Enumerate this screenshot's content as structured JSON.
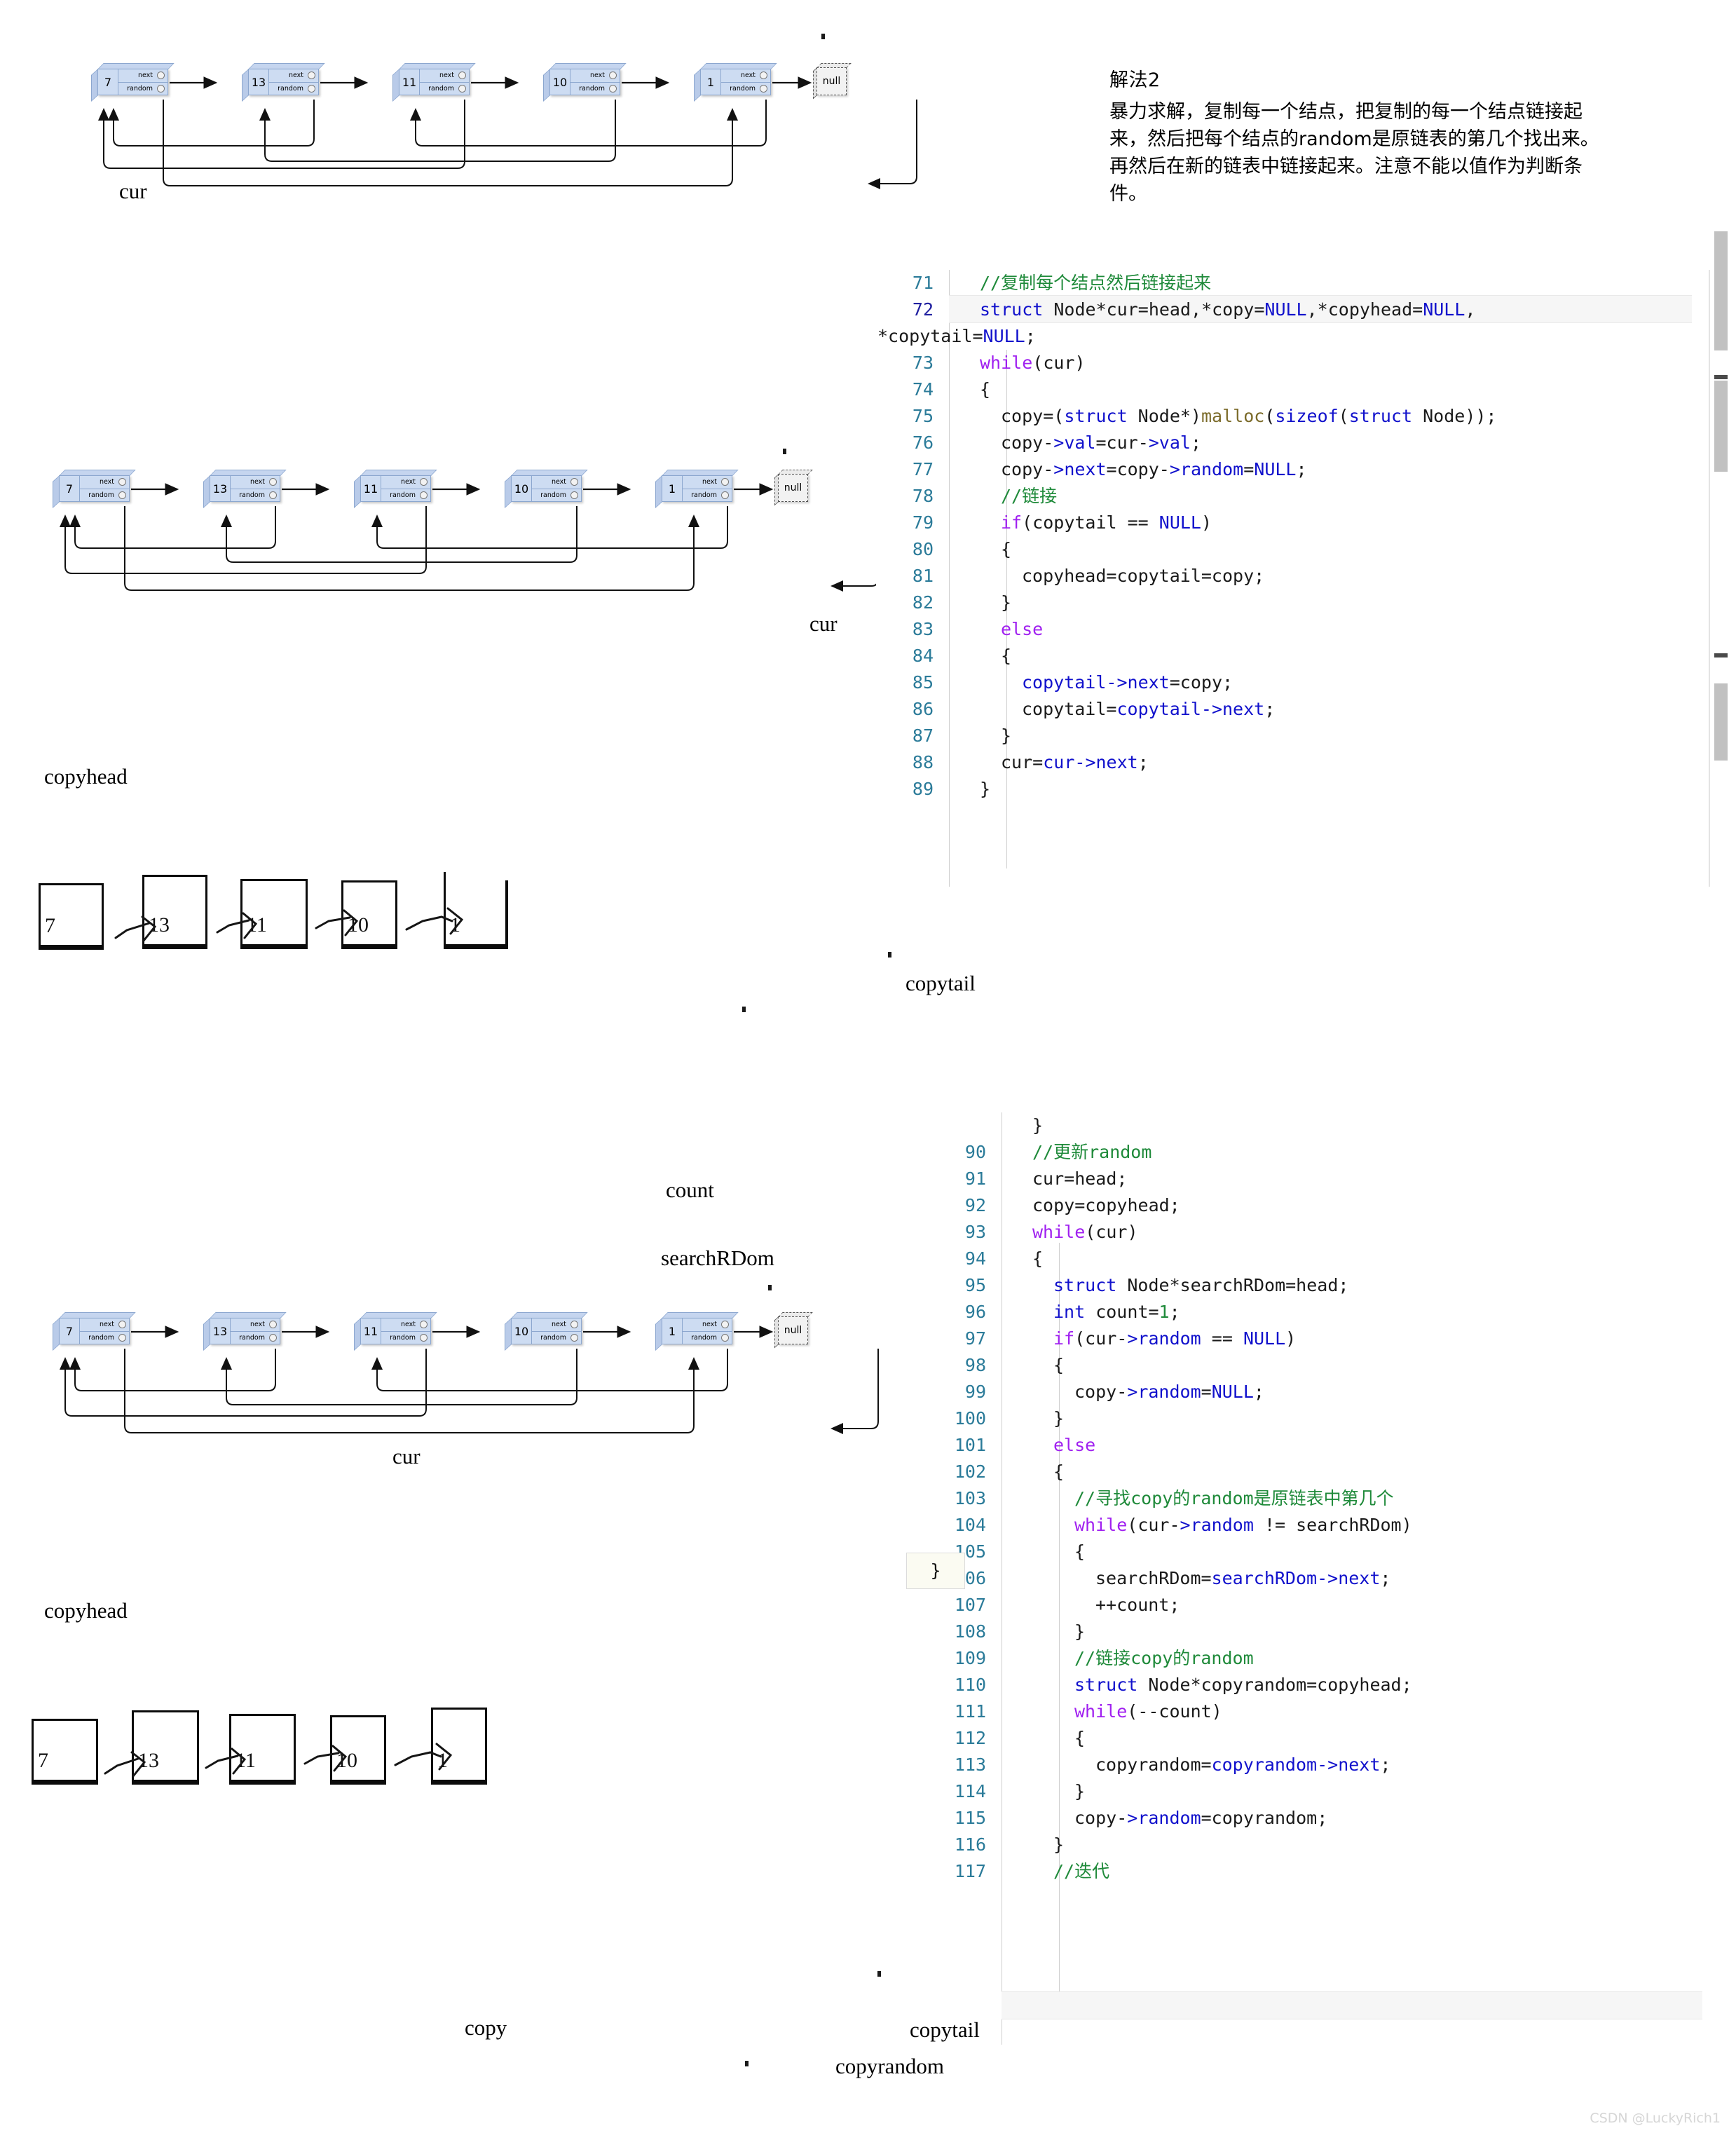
{
  "notes": {
    "title": "解法2",
    "body": "暴力求解，复制每一个结点，把复制的每一个结点链接起来，然后把每个结点的random是原链表的第几个找出来。再然后在新的链表中链接起来。注意不能以值作为判断条件。"
  },
  "diagram1": {
    "nodes": [
      {
        "value": "7",
        "next_label": "next",
        "random_label": "random"
      },
      {
        "value": "13",
        "next_label": "next",
        "random_label": "random"
      },
      {
        "value": "11",
        "next_label": "next",
        "random_label": "random"
      },
      {
        "value": "10",
        "next_label": "next",
        "random_label": "random"
      },
      {
        "value": "1",
        "next_label": "next",
        "random_label": "random"
      }
    ],
    "terminator": "null",
    "pointer_labels": [
      "cur"
    ]
  },
  "diagram2": {
    "nodes": [
      {
        "value": "7",
        "next_label": "next",
        "random_label": "random"
      },
      {
        "value": "13",
        "next_label": "next",
        "random_label": "random"
      },
      {
        "value": "11",
        "next_label": "next",
        "random_label": "random"
      },
      {
        "value": "10",
        "next_label": "next",
        "random_label": "random"
      },
      {
        "value": "1",
        "next_label": "next",
        "random_label": "random"
      }
    ],
    "terminator": "null",
    "pointer_labels": [
      "cur"
    ]
  },
  "diagram3": {
    "boxes": [
      "7",
      "13",
      "11",
      "10",
      "1"
    ],
    "labels": {
      "head": "copyhead",
      "tail": "copytail"
    }
  },
  "diagram4": {
    "nodes": [
      {
        "value": "7",
        "next_label": "next",
        "random_label": "random"
      },
      {
        "value": "13",
        "next_label": "next",
        "random_label": "random"
      },
      {
        "value": "11",
        "next_label": "next",
        "random_label": "random"
      },
      {
        "value": "10",
        "next_label": "next",
        "random_label": "random"
      },
      {
        "value": "1",
        "next_label": "next",
        "random_label": "random"
      }
    ],
    "terminator": "null",
    "pointer_labels": [
      "count",
      "searchRDom",
      "cur"
    ]
  },
  "diagram5": {
    "boxes": [
      "7",
      "13",
      "11",
      "10",
      "1"
    ],
    "labels": {
      "head": "copyhead",
      "copy": "copy",
      "tail": "copytail",
      "copyrandom": "copyrandom"
    }
  },
  "code_block_1": {
    "lines": [
      {
        "num": "71",
        "indent": 1,
        "tokens": [
          {
            "t": "//复制每个结点然后链接起来",
            "c": "k-cm"
          }
        ]
      },
      {
        "num": "72",
        "indent": 1,
        "highlight": true,
        "tokens": [
          {
            "t": "struct",
            "c": "k-type"
          },
          {
            "t": " Node*cur=head,*copy=",
            "c": ""
          },
          {
            "t": "NULL",
            "c": "k-null"
          },
          {
            "t": ",*copyhead=",
            "c": ""
          },
          {
            "t": "NULL",
            "c": "k-null"
          },
          {
            "t": ",",
            "c": ""
          }
        ]
      },
      {
        "num": "",
        "wrap": true,
        "tokens": [
          {
            "t": "*copytail=",
            "c": ""
          },
          {
            "t": "NULL",
            "c": "k-null"
          },
          {
            "t": ";",
            "c": ""
          }
        ]
      },
      {
        "num": "73",
        "indent": 1,
        "tokens": [
          {
            "t": "while",
            "c": "k-kw"
          },
          {
            "t": "(cur)",
            "c": ""
          }
        ]
      },
      {
        "num": "74",
        "indent": 1,
        "tokens": [
          {
            "t": "{",
            "c": ""
          }
        ]
      },
      {
        "num": "75",
        "indent": 2,
        "tokens": [
          {
            "t": "copy=(",
            "c": ""
          },
          {
            "t": "struct",
            "c": "k-type"
          },
          {
            "t": " Node*)",
            "c": ""
          },
          {
            "t": "malloc",
            "c": "k-fn"
          },
          {
            "t": "(",
            "c": ""
          },
          {
            "t": "sizeof",
            "c": "k-type"
          },
          {
            "t": "(",
            "c": ""
          },
          {
            "t": "struct",
            "c": "k-type"
          },
          {
            "t": " Node));",
            "c": ""
          }
        ]
      },
      {
        "num": "76",
        "indent": 2,
        "tokens": [
          {
            "t": "copy-",
            "c": ""
          },
          {
            "t": ">val",
            "c": "k-mem"
          },
          {
            "t": "=cur-",
            "c": ""
          },
          {
            "t": ">val",
            "c": "k-mem"
          },
          {
            "t": ";",
            "c": ""
          }
        ]
      },
      {
        "num": "77",
        "indent": 2,
        "tokens": [
          {
            "t": "copy-",
            "c": ""
          },
          {
            "t": ">next",
            "c": "k-mem"
          },
          {
            "t": "=copy-",
            "c": ""
          },
          {
            "t": ">random",
            "c": "k-mem"
          },
          {
            "t": "=",
            "c": ""
          },
          {
            "t": "NULL",
            "c": "k-null"
          },
          {
            "t": ";",
            "c": ""
          }
        ]
      },
      {
        "num": "78",
        "indent": 2,
        "tokens": [
          {
            "t": "//链接",
            "c": "k-cm"
          }
        ]
      },
      {
        "num": "79",
        "indent": 2,
        "tokens": [
          {
            "t": "if",
            "c": "k-kw"
          },
          {
            "t": "(copytail == ",
            "c": ""
          },
          {
            "t": "NULL",
            "c": "k-null"
          },
          {
            "t": ")",
            "c": ""
          }
        ]
      },
      {
        "num": "80",
        "indent": 2,
        "tokens": [
          {
            "t": "{",
            "c": ""
          }
        ]
      },
      {
        "num": "81",
        "indent": 3,
        "tokens": [
          {
            "t": "copyhead=copytail=copy;",
            "c": ""
          }
        ]
      },
      {
        "num": "82",
        "indent": 2,
        "tokens": [
          {
            "t": "}",
            "c": ""
          }
        ]
      },
      {
        "num": "83",
        "indent": 2,
        "tokens": [
          {
            "t": "else",
            "c": "k-kw"
          }
        ]
      },
      {
        "num": "84",
        "indent": 2,
        "tokens": [
          {
            "t": "{",
            "c": ""
          }
        ]
      },
      {
        "num": "85",
        "indent": 3,
        "tokens": [
          {
            "t": "copytail-",
            "c": "k-mem"
          },
          {
            "t": ">next",
            "c": "k-mem"
          },
          {
            "t": "=copy;",
            "c": ""
          }
        ]
      },
      {
        "num": "86",
        "indent": 3,
        "tokens": [
          {
            "t": "copytail=",
            "c": ""
          },
          {
            "t": "copytail-",
            "c": "k-mem"
          },
          {
            "t": ">next",
            "c": "k-mem"
          },
          {
            "t": ";",
            "c": ""
          }
        ]
      },
      {
        "num": "87",
        "indent": 2,
        "tokens": [
          {
            "t": "}",
            "c": ""
          }
        ]
      },
      {
        "num": "88",
        "indent": 2,
        "tokens": [
          {
            "t": "cur=",
            "c": ""
          },
          {
            "t": "cur-",
            "c": "k-mem"
          },
          {
            "t": ">next",
            "c": "k-mem"
          },
          {
            "t": ";",
            "c": ""
          }
        ]
      },
      {
        "num": "89",
        "indent": 1,
        "clipped": true,
        "tokens": [
          {
            "t": "}",
            "c": ""
          }
        ]
      }
    ]
  },
  "code_block_2": {
    "lines": [
      {
        "num": "",
        "indent": 1,
        "clipped_top": true,
        "tokens": [
          {
            "t": "}",
            "c": ""
          }
        ]
      },
      {
        "num": "90",
        "indent": 1,
        "tokens": [
          {
            "t": "//更新random",
            "c": "k-cm"
          }
        ]
      },
      {
        "num": "91",
        "indent": 1,
        "tokens": [
          {
            "t": "cur=head;",
            "c": ""
          }
        ]
      },
      {
        "num": "92",
        "indent": 1,
        "tokens": [
          {
            "t": "copy=copyhead;",
            "c": ""
          }
        ]
      },
      {
        "num": "93",
        "indent": 1,
        "tokens": [
          {
            "t": "while",
            "c": "k-kw"
          },
          {
            "t": "(cur)",
            "c": ""
          }
        ]
      },
      {
        "num": "94",
        "indent": 1,
        "tokens": [
          {
            "t": "{",
            "c": ""
          }
        ]
      },
      {
        "num": "95",
        "indent": 2,
        "tokens": [
          {
            "t": "struct",
            "c": "k-type"
          },
          {
            "t": " Node*searchRDom=head;",
            "c": ""
          }
        ]
      },
      {
        "num": "96",
        "indent": 2,
        "tokens": [
          {
            "t": "int",
            "c": "k-type"
          },
          {
            "t": " count=",
            "c": ""
          },
          {
            "t": "1",
            "c": "k-num"
          },
          {
            "t": ";",
            "c": ""
          }
        ]
      },
      {
        "num": "97",
        "indent": 2,
        "tokens": [
          {
            "t": "if",
            "c": "k-kw"
          },
          {
            "t": "(cur-",
            "c": ""
          },
          {
            "t": ">random",
            "c": "k-mem"
          },
          {
            "t": " == ",
            "c": ""
          },
          {
            "t": "NULL",
            "c": "k-null"
          },
          {
            "t": ")",
            "c": ""
          }
        ]
      },
      {
        "num": "98",
        "indent": 2,
        "tokens": [
          {
            "t": "{",
            "c": ""
          }
        ]
      },
      {
        "num": "99",
        "indent": 3,
        "tokens": [
          {
            "t": "copy-",
            "c": ""
          },
          {
            "t": ">random",
            "c": "k-mem"
          },
          {
            "t": "=",
            "c": ""
          },
          {
            "t": "NULL",
            "c": "k-null"
          },
          {
            "t": ";",
            "c": ""
          }
        ]
      },
      {
        "num": "100",
        "indent": 2,
        "tokens": [
          {
            "t": "}",
            "c": ""
          }
        ]
      },
      {
        "num": "101",
        "indent": 2,
        "tokens": [
          {
            "t": "else",
            "c": "k-kw"
          }
        ]
      },
      {
        "num": "102",
        "indent": 2,
        "tokens": [
          {
            "t": "{",
            "c": ""
          }
        ]
      },
      {
        "num": "103",
        "indent": 3,
        "tokens": [
          {
            "t": "//寻找copy的random是原链表中第几个",
            "c": "k-cm"
          }
        ]
      },
      {
        "num": "104",
        "indent": 3,
        "tokens": [
          {
            "t": "while",
            "c": "k-kw"
          },
          {
            "t": "(cur-",
            "c": ""
          },
          {
            "t": ">random",
            "c": "k-mem"
          },
          {
            "t": " != searchRDom)",
            "c": ""
          }
        ]
      },
      {
        "num": "105",
        "indent": 3,
        "tokens": [
          {
            "t": "{",
            "c": ""
          }
        ]
      },
      {
        "num": "106",
        "indent": 4,
        "tokens": [
          {
            "t": "searchRDom=",
            "c": ""
          },
          {
            "t": "searchRDom-",
            "c": "k-mem"
          },
          {
            "t": ">next",
            "c": "k-mem"
          },
          {
            "t": ";",
            "c": ""
          }
        ]
      },
      {
        "num": "107",
        "indent": 4,
        "tokens": [
          {
            "t": "++count;",
            "c": ""
          }
        ]
      },
      {
        "num": "108",
        "indent": 3,
        "tokens": [
          {
            "t": "}",
            "c": ""
          }
        ]
      },
      {
        "num": "109",
        "indent": 3,
        "tokens": [
          {
            "t": "//链接copy的random",
            "c": "k-cm"
          }
        ]
      },
      {
        "num": "110",
        "indent": 3,
        "tokens": [
          {
            "t": "struct",
            "c": "k-type"
          },
          {
            "t": " Node*copyrandom=copyhead;",
            "c": ""
          }
        ]
      },
      {
        "num": "111",
        "indent": 3,
        "tokens": [
          {
            "t": "while",
            "c": "k-kw"
          },
          {
            "t": "(--count)",
            "c": ""
          }
        ]
      },
      {
        "num": "112",
        "indent": 3,
        "tokens": [
          {
            "t": "{",
            "c": ""
          }
        ]
      },
      {
        "num": "113",
        "indent": 4,
        "tokens": [
          {
            "t": "copyrandom=",
            "c": ""
          },
          {
            "t": "copyrandom-",
            "c": "k-mem"
          },
          {
            "t": ">next",
            "c": "k-mem"
          },
          {
            "t": ";",
            "c": ""
          }
        ]
      },
      {
        "num": "114",
        "indent": 3,
        "tokens": [
          {
            "t": "}",
            "c": ""
          }
        ]
      },
      {
        "num": "115",
        "indent": 3,
        "tokens": [
          {
            "t": "copy-",
            "c": ""
          },
          {
            "t": ">random",
            "c": "k-mem"
          },
          {
            "t": "=copyrandom;",
            "c": ""
          }
        ]
      },
      {
        "num": "116",
        "indent": 2,
        "tokens": [
          {
            "t": "}",
            "c": ""
          }
        ]
      },
      {
        "num": "117",
        "indent": 2,
        "highlight": true,
        "tokens": [
          {
            "t": "//迭代",
            "c": "k-cm"
          }
        ]
      }
    ]
  },
  "watermark": "CSDN @LuckyRich1",
  "colors": {
    "node_fill": "#cddcf2",
    "node_stroke": "#8ca7cf",
    "comment": "#1f8a3a",
    "keyword": "#a020f0",
    "type": "#1111cc",
    "linenum": "#2b7b99",
    "scrollbar": "#c1c1c1"
  }
}
